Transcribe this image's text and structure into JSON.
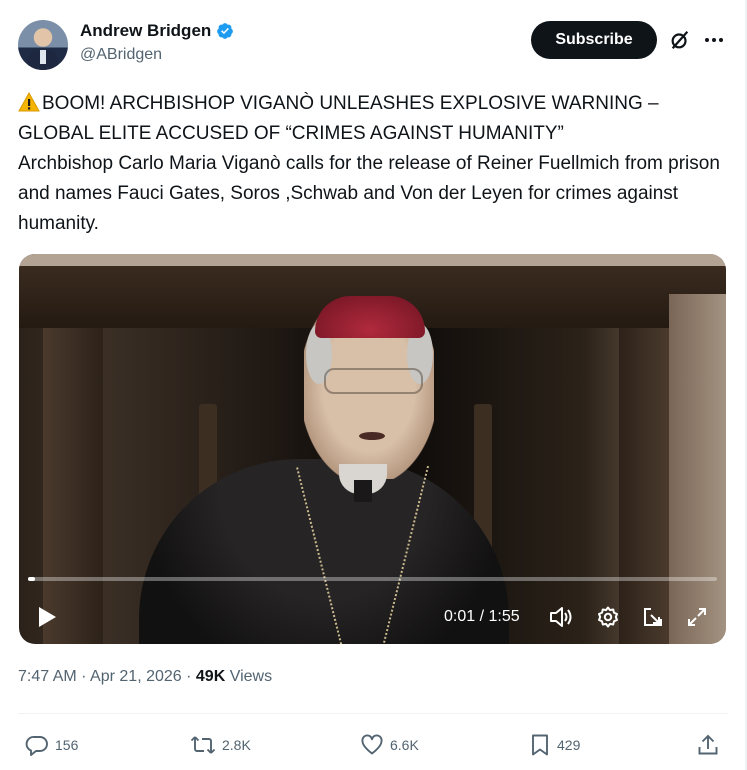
{
  "author": {
    "name": "Andrew Bridgen",
    "handle": "@ABridgen",
    "verified": true,
    "verified_color": "#1d9bf0"
  },
  "header": {
    "subscribe_label": "Subscribe",
    "grok_icon": "grok-icon",
    "more_icon": "more-icon"
  },
  "tweet": {
    "warning_icon": "warning-sign-icon",
    "line1": "BOOM! ARCHBISHOP VIGANÒ UNLEASHES EXPLOSIVE WARNING – GLOBAL ELITE ACCUSED OF “CRIMES AGAINST HUMANITY”",
    "line2": "Archbishop Carlo Maria Viganò calls for the release of Reiner Fuellmich from prison and names Fauci Gates, Soros ,Schwab and Von der Leyen for crimes against humanity."
  },
  "video": {
    "time": "0:01 / 1:55",
    "progress": 0.01
  },
  "meta": {
    "time": "7:47 AM",
    "separator": " · ",
    "date": "Apr 21, 2026",
    "views_count": "49K",
    "views_label": " Views"
  },
  "actions": {
    "replies": "156",
    "reposts": "2.8K",
    "likes": "6.6K",
    "bookmarks": "429"
  },
  "colors": {
    "text": "#0f1419",
    "secondary": "#536471",
    "subscribe_bg": "#0f1419"
  }
}
